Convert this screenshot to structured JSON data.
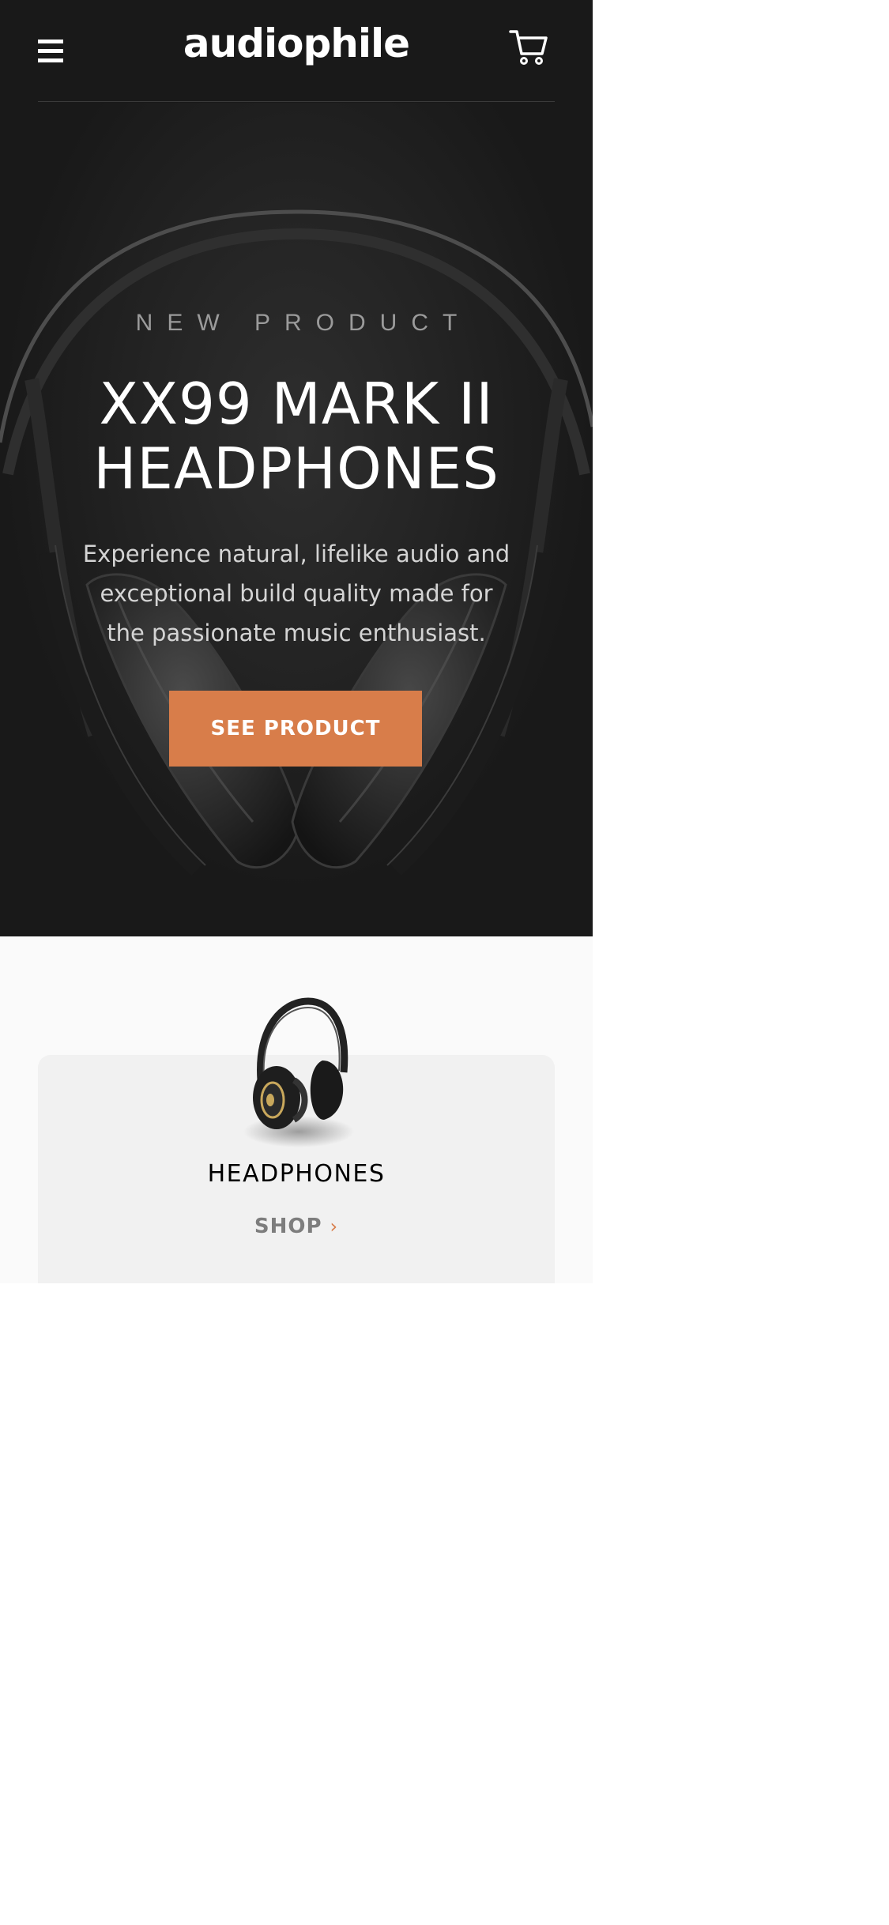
{
  "header": {
    "logo": "audiophile",
    "menu_icon": "hamburger-menu-icon",
    "cart_icon": "shopping-cart-icon"
  },
  "hero": {
    "overline": "NEW PRODUCT",
    "title_line1": "XX99 MARK II",
    "title_line2": "HEADPHONES",
    "description": "Experience natural, lifelike audio and exceptional build quality made for the passionate music enthusiast.",
    "cta_label": "SEE PRODUCT"
  },
  "category": {
    "name": "HEADPHONES",
    "shop_label": "SHOP",
    "shop_icon": "chevron-right-icon"
  },
  "colors": {
    "hero_bg": "#191919",
    "accent": "#d87d4a",
    "section_bg": "#fafafa",
    "card_bg": "#f1f1f1"
  }
}
